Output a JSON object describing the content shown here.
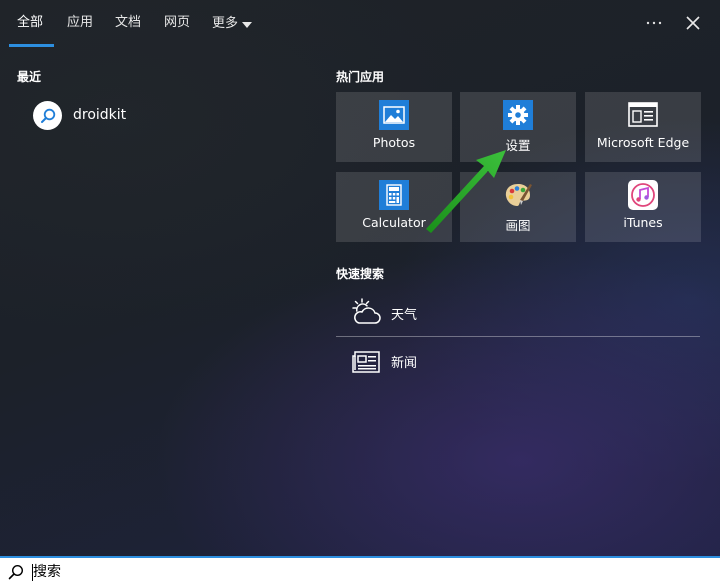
{
  "tabs": [
    {
      "label": "全部",
      "active": true
    },
    {
      "label": "应用"
    },
    {
      "label": "文档"
    },
    {
      "label": "网页"
    },
    {
      "label": "更多"
    }
  ],
  "toolbar": {
    "more_options": "···",
    "close_icon": "close-icon"
  },
  "recent": {
    "title": "最近",
    "items": [
      {
        "label": "droidkit",
        "icon": "search-icon"
      }
    ]
  },
  "top_apps": {
    "title": "热门应用",
    "tiles": [
      {
        "label": "Photos",
        "icon": "photos-icon",
        "color": "#1f7ed8"
      },
      {
        "label": "设置",
        "icon": "settings-gear-icon",
        "color": "#1f7ed8"
      },
      {
        "label": "Microsoft Edge",
        "icon": "edge-icon",
        "color": "#ffffff"
      },
      {
        "label": "Calculator",
        "icon": "calculator-icon",
        "color": "#1f7ed8"
      },
      {
        "label": "画图",
        "icon": "paint-palette-icon",
        "color": "#e8c88a"
      },
      {
        "label": "iTunes",
        "icon": "itunes-icon",
        "color": "#ffffff"
      }
    ]
  },
  "quick_search": {
    "title": "快速搜索",
    "items": [
      {
        "label": "天气",
        "icon": "weather-icon"
      },
      {
        "label": "新闻",
        "icon": "news-icon"
      }
    ]
  },
  "search": {
    "placeholder": "搜索",
    "value": ""
  },
  "colors": {
    "accent": "#2d8fe0",
    "annotation_arrow": "#1f9a1f"
  }
}
